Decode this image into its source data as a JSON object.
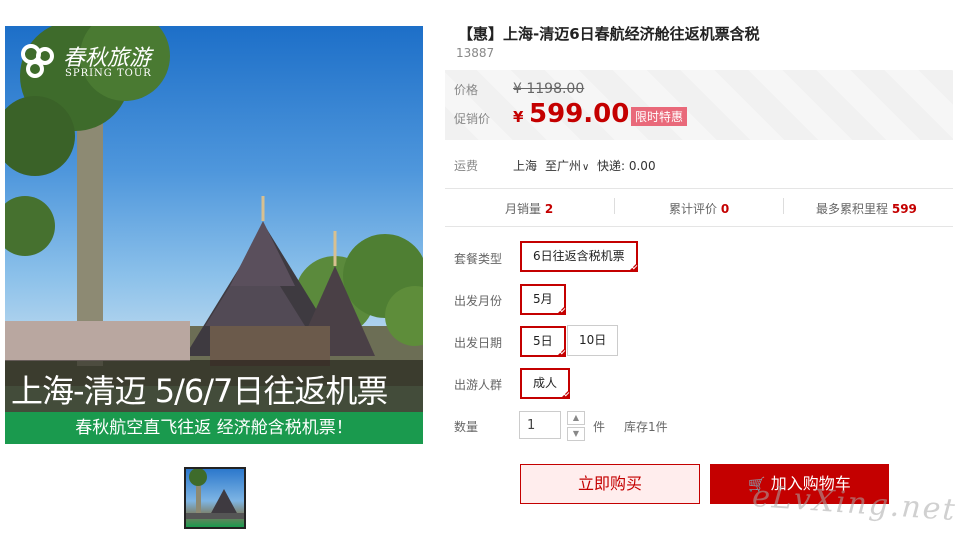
{
  "hero": {
    "logo_cn": "春秋旅游",
    "logo_en": "SPRING TOUR",
    "banner": "上海-清迈 5/6/7日往返机票",
    "subbanner": "春秋航空直飞往返 经济舱含税机票！"
  },
  "product": {
    "title": "【惠】上海-清迈6日春航经济舱往返机票含税",
    "sku": "13887"
  },
  "price": {
    "orig_label": "价格",
    "orig_value": "¥ 1198.00",
    "sale_label": "促销价",
    "sale_currency": "¥",
    "sale_value": "599.00",
    "promo_tag": "限时特惠"
  },
  "shipping": {
    "label": "运费",
    "from": "上海",
    "to": "至广州",
    "express": "快递: 0.00"
  },
  "stats": {
    "sales_label": "月销量",
    "sales_value": "2",
    "reviews_label": "累计评价",
    "reviews_value": "0",
    "miles_label": "最多累积里程",
    "miles_value": "599"
  },
  "options": {
    "package_label": "套餐类型",
    "package_value": "6日往返含税机票",
    "month_label": "出发月份",
    "month_value": "5月",
    "date_label": "出发日期",
    "dates": [
      "5日",
      "10日"
    ],
    "group_label": "出游人群",
    "group_value": "成人"
  },
  "quantity": {
    "label": "数量",
    "value": "1",
    "unit": "件",
    "stock": "库存1件"
  },
  "actions": {
    "buy_now": "立即购买",
    "add_cart": "加入购物车"
  },
  "watermark": "eLvXing.net",
  "colors": {
    "accent": "#c40000",
    "promo_tag": "#e9697a",
    "banner_green": "#1a9a4e"
  }
}
